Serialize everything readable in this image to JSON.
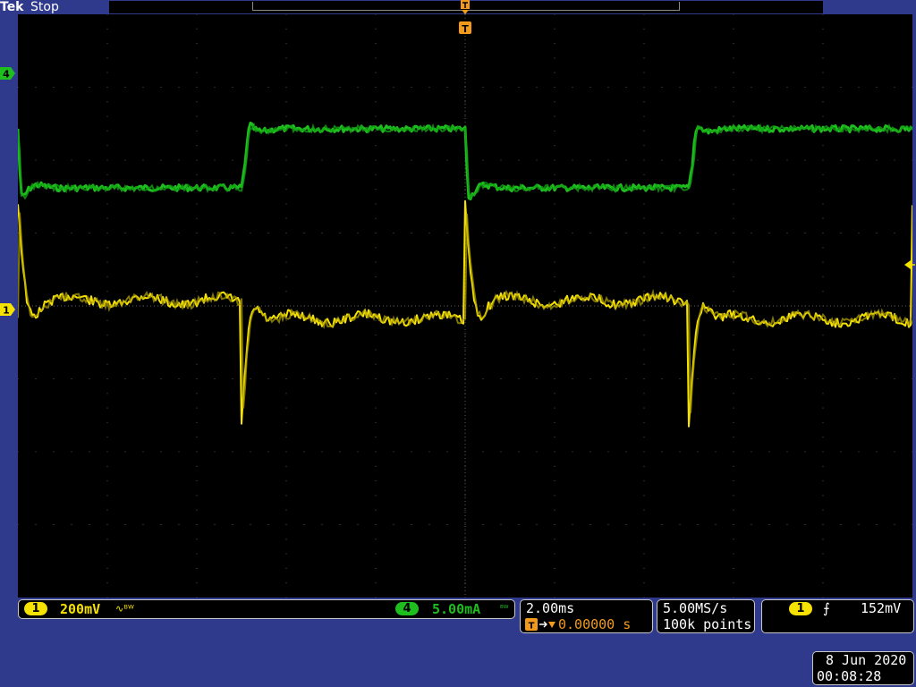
{
  "header": {
    "brand": "Tek",
    "acquisition_state": "Stop"
  },
  "screen": {
    "ch1_marker": "1",
    "ch4_marker": "4",
    "trigger_marker": "T"
  },
  "channels": [
    {
      "number": "1",
      "scale": "200mV",
      "coupling_icon": "ac-coupling-icon",
      "coupling_glyph": "∿ᴮᵂ",
      "color": "#f5e200"
    },
    {
      "number": "4",
      "scale": "5.00mA",
      "coupling_icon": "bandwidth-icon",
      "coupling_glyph": "ᴮᵂ",
      "color": "#1fbe1f"
    }
  ],
  "horizontal": {
    "time_per_div": "2.00ms",
    "trigger_delay": "0.00000 s"
  },
  "acquisition": {
    "sample_rate": "5.00MS/s",
    "record_length": "100k points"
  },
  "trigger": {
    "source": "1",
    "slope_icon": "rising-edge-icon",
    "slope_glyph": "⨍",
    "level": "152mV"
  },
  "datetime": {
    "date": "8 Jun 2020",
    "time": "00:08:28"
  },
  "colors": {
    "background": "#2f3a8c",
    "graticule": "#000000",
    "ch1": "#f5e200",
    "ch4": "#1fbe1f",
    "trigger": "#f39a1a"
  }
}
